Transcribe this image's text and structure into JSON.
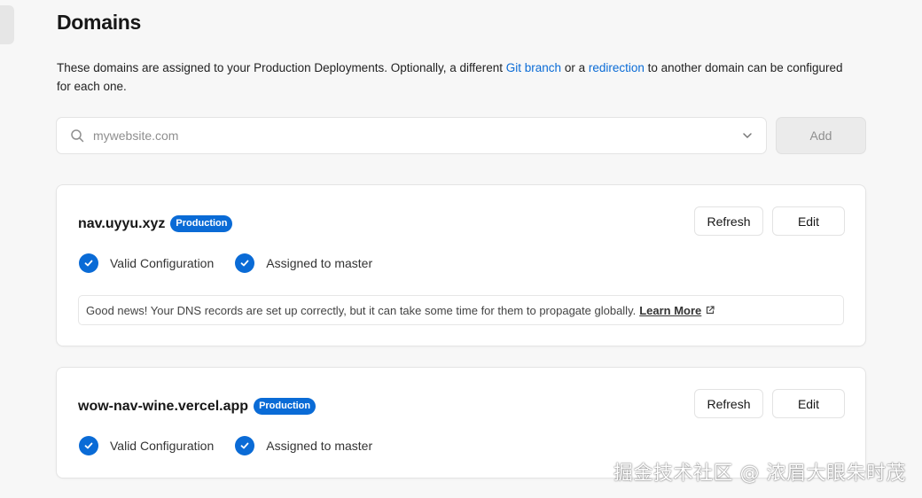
{
  "page": {
    "title": "Domains",
    "description": {
      "part1": "These domains are assigned to your Production Deployments. Optionally, a different ",
      "link1": "Git branch",
      "part2": " or a ",
      "link2": "redirection",
      "part3": " to another domain can be configured for each one."
    }
  },
  "search": {
    "placeholder": "mywebsite.com",
    "value": "",
    "icon": "search-icon",
    "dropdown_icon": "chevron-down-icon"
  },
  "add_button": {
    "label": "Add",
    "state": "disabled"
  },
  "domains": [
    {
      "name": "nav.uyyu.xyz",
      "badge": "Production",
      "refresh_label": "Refresh",
      "edit_label": "Edit",
      "statuses": [
        "Valid Configuration",
        "Assigned to master"
      ],
      "info": {
        "text": "Good news! Your DNS records are set up correctly, but it can take some time for them to propagate globally.",
        "link": "Learn More"
      }
    },
    {
      "name": "wow-nav-wine.vercel.app",
      "badge": "Production",
      "refresh_label": "Refresh",
      "edit_label": "Edit",
      "statuses": [
        "Valid Configuration",
        "Assigned to master"
      ]
    }
  ],
  "watermark": "掘金技术社区 @ 浓眉大眼朱时茂",
  "colors": {
    "accent": "#0a6bd6",
    "background": "#f7f7f7",
    "card": "#ffffff"
  }
}
